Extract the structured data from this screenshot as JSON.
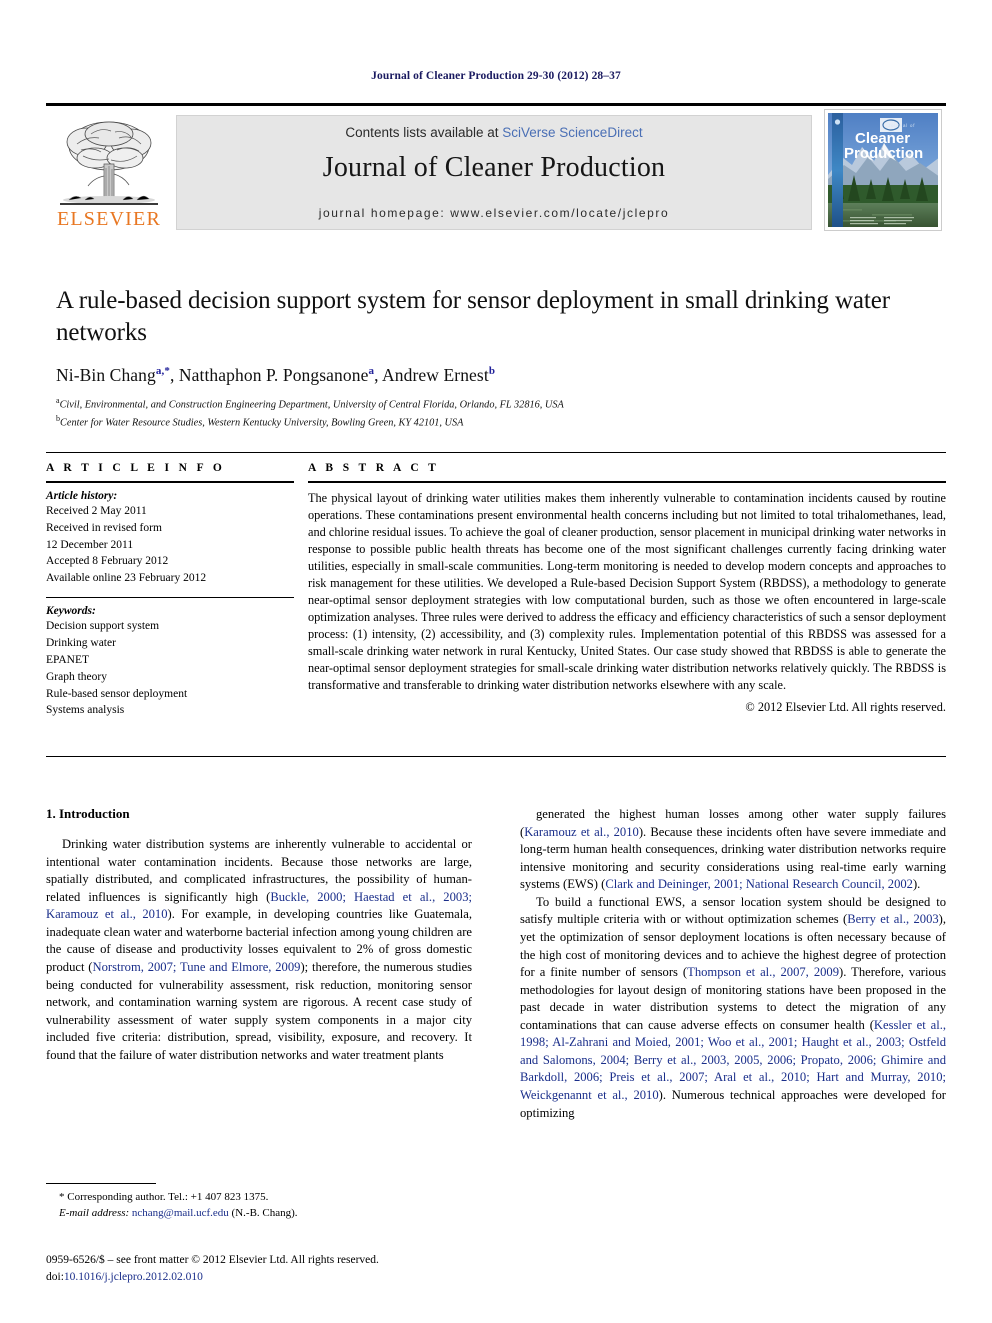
{
  "running_head": "Journal of Cleaner Production 29-30 (2012) 28–37",
  "masthead": {
    "contents_prefix": "Contents lists available at ",
    "sciencedirect": "SciVerse ScienceDirect",
    "journal_title": "Journal of Cleaner Production",
    "homepage": "journal homepage: www.elsevier.com/locate/jclepro",
    "publisher_wordmark": "ELSEVIER",
    "publisher_color": "#E87722",
    "link_color": "#4a6fb5",
    "cover": {
      "line1": "Journal of",
      "line2": "Cleaner",
      "line3": "Production"
    }
  },
  "article": {
    "title": "A rule-based decision support system for sensor deployment in small drinking water networks",
    "authors_html": "Ni-Bin Chang<sup>a,</sup><sup>*</sup>, Natthaphon P. Pongsanone<sup>a</sup>, Andrew Ernest<sup>b</sup>",
    "affiliation_a": "Civil, Environmental, and Construction Engineering Department, University of Central Florida, Orlando, FL 32816, USA",
    "affiliation_b": "Center for Water Resource Studies, Western Kentucky University, Bowling Green, KY 42101, USA"
  },
  "article_info": {
    "heading": "A R T I C L E   I N F O",
    "history_label": "Article history:",
    "history": [
      "Received 2 May 2011",
      "Received in revised form",
      "12 December 2011",
      "Accepted 8 February 2012",
      "Available online 23 February 2012"
    ],
    "keywords_label": "Keywords:",
    "keywords": [
      "Decision support system",
      "Drinking water",
      "EPANET",
      "Graph theory",
      "Rule-based sensor deployment",
      "Systems analysis"
    ]
  },
  "abstract": {
    "heading": "A B S T R A C T",
    "text": "The physical layout of drinking water utilities makes them inherently vulnerable to contamination incidents caused by routine operations. These contaminations present environmental health concerns including but not limited to total trihalomethanes, lead, and chlorine residual issues. To achieve the goal of cleaner production, sensor placement in municipal drinking water networks in response to possible public health threats has become one of the most significant challenges currently facing drinking water utilities, especially in small-scale communities. Long-term monitoring is needed to develop modern concepts and approaches to risk management for these utilities. We developed a Rule-based Decision Support System (RBDSS), a methodology to generate near-optimal sensor deployment strategies with low computational burden, such as those we often encountered in large-scale optimization analyses. Three rules were derived to address the efficacy and efficiency characteristics of such a sensor deployment process: (1) intensity, (2) accessibility, and (3) complexity rules. Implementation potential of this RBDSS was assessed for a small-scale drinking water network in rural Kentucky, United States. Our case study showed that RBDSS is able to generate the near-optimal sensor deployment strategies for small-scale drinking water distribution networks relatively quickly. The RBDSS is transformative and transferable to drinking water distribution networks elsewhere with any scale.",
    "copyright": "© 2012 Elsevier Ltd. All rights reserved."
  },
  "body": {
    "section_heading": "1.  Introduction",
    "left_paragraphs_html": [
      "Drinking water distribution systems are inherently vulnerable to accidental or intentional water contamination incidents. Because those networks are large, spatially distributed, and complicated infrastructures, the possibility of human-related influences is significantly high (<span class=\"cite\">Buckle, 2000; Haestad et al., 2003; Karamouz et al., 2010</span>). For example, in developing countries like Guatemala, inadequate clean water and waterborne bacterial infection among young children are the cause of disease and productivity losses equivalent to 2% of gross domestic product (<span class=\"cite\">Norstrom, 2007; Tune and Elmore, 2009</span>); therefore, the numerous studies being conducted for vulnerability assessment, risk reduction, monitoring sensor network, and contamination warning system are rigorous. A recent case study of vulnerability assessment of water supply system components in a major city included five criteria: distribution, spread, visibility, exposure, and recovery. It found that the failure of water distribution networks and water treatment plants"
    ],
    "right_paragraphs_html": [
      "generated the highest human losses among other water supply failures (<span class=\"cite\">Karamouz et al., 2010</span>). Because these incidents often have severe immediate and long-term human health consequences, drinking water distribution networks require intensive monitoring and security considerations using real-time early warning systems (EWS) (<span class=\"cite\">Clark and Deininger, 2001; National Research Council, 2002</span>).",
      "To build a functional EWS, a sensor location system should be designed to satisfy multiple criteria with or without optimization schemes (<span class=\"cite\">Berry et al., 2003</span>), yet the optimization of sensor deployment locations is often necessary because of the high cost of monitoring devices and to achieve the highest degree of protection for a finite number of sensors (<span class=\"cite\">Thompson et al., 2007, 2009</span>). Therefore, various methodologies for layout design of monitoring stations have been proposed in the past decade in water distribution systems to detect the migration of any contaminations that can cause adverse effects on consumer health (<span class=\"cite\">Kessler et al., 1998; Al-Zahrani and Moied, 2001; Woo et al., 2001; Haught et al., 2003; Ostfeld and Salomons, 2004; Berry et al., 2003, 2005, 2006; Propato, 2006; Ghimire and Barkdoll, 2006; Preis et al., 2007; Aral et al., 2010; Hart and Murray, 2010; Weickgenannt et al., 2010</span>). Numerous technical approaches were developed for optimizing"
    ]
  },
  "footnote": {
    "corresponding": "* Corresponding author. Tel.: +1 407 823 1375.",
    "email_label": "E-mail address:",
    "email": "nchang@mail.ucf.edu",
    "email_suffix": "(N.-B. Chang)."
  },
  "footer": {
    "issn_line": "0959-6526/$ – see front matter © 2012 Elsevier Ltd. All rights reserved.",
    "doi_label": "doi:",
    "doi": "10.1016/j.jclepro.2012.02.010"
  }
}
